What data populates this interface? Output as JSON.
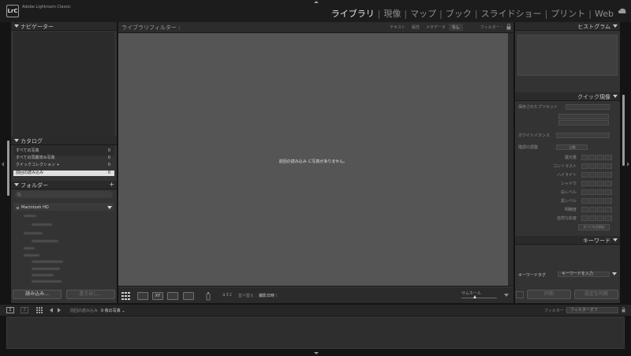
{
  "app": {
    "logo_text": "LrC",
    "title": "Adobe Lightroom Classic"
  },
  "modules": [
    {
      "label": "ライブラリ",
      "active": true
    },
    {
      "label": "現像",
      "active": false
    },
    {
      "label": "マップ",
      "active": false
    },
    {
      "label": "ブック",
      "active": false
    },
    {
      "label": "スライドショー",
      "active": false
    },
    {
      "label": "プリント",
      "active": false
    },
    {
      "label": "Web",
      "active": false
    }
  ],
  "left_panel": {
    "navigator_title": "ナビゲーター",
    "catalog_title": "カタログ",
    "catalog_items": [
      {
        "label": "すべての写真",
        "count": "0"
      },
      {
        "label": "すべての同期済み写真",
        "count": "0"
      },
      {
        "label": "クイックコレクション +",
        "count": "0"
      },
      {
        "label": "前回の読み込み",
        "count": "0"
      }
    ],
    "folders_title": "フォルダー",
    "volume_name": "Macintosh HD",
    "import_button": "読み込み...",
    "export_button": "書き出し..."
  },
  "library_filter": {
    "title": "ライブラリフィルター :",
    "tabs": [
      {
        "label": "テキスト",
        "active": false
      },
      {
        "label": "属性",
        "active": false
      },
      {
        "label": "メタデータ",
        "active": false
      },
      {
        "label": "なし",
        "active": true
      }
    ],
    "preset_label": "フィルター ⁝"
  },
  "grid": {
    "empty_message": "前回の読み込み に写真がありません。"
  },
  "toolbar": {
    "sort_label": "並べ替え :",
    "sort_value": "撮影日時 ⁝",
    "thumbnail_label": "サムネール"
  },
  "right_panel": {
    "histogram_title": "ヒストグラム",
    "quick_develop_title": "クイック現像",
    "saved_preset_label": "保存されたプリセット",
    "white_balance_label": "ホワイトバランス",
    "tone_control_label": "階調の調整",
    "tone_auto": "自動",
    "tone_rows": [
      "露光量",
      "コントラスト",
      "ハイライト",
      "シャドウ",
      "白レベル",
      "黒レベル",
      "明瞭度",
      "自然な彩度"
    ],
    "reset_all": "すべてを初期化",
    "keywording_title": "キーワード",
    "keyword_tags_label": "キーワードタグ",
    "keyword_tags_value": "キーワードを入力",
    "sync_button": "同期",
    "sync_settings_button": "設定を同期"
  },
  "filmstrip_bar": {
    "monitor_1": "1",
    "monitor_2": "2",
    "source": "前回の読み込み",
    "photo_count": "0 枚の写真 ⌄",
    "filter_label": "フィルター :",
    "filter_value": "フィルターオフ"
  }
}
